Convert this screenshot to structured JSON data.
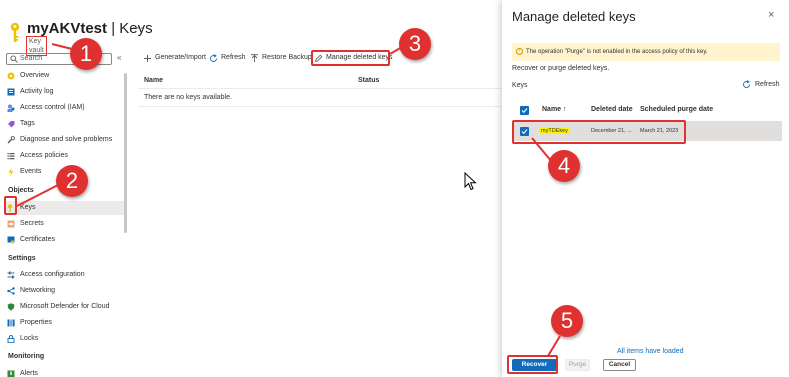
{
  "header": {
    "resource_name": "myAKVtest",
    "separator": "|",
    "page": "Keys",
    "more": "···",
    "resource_type": "Key vault"
  },
  "search": {
    "placeholder": "Search",
    "collapse": "«"
  },
  "sidebar": {
    "items": [
      {
        "label": "Overview",
        "icon": "overview-icon"
      },
      {
        "label": "Activity log",
        "icon": "activity-log-icon"
      },
      {
        "label": "Access control (IAM)",
        "icon": "iam-icon"
      },
      {
        "label": "Tags",
        "icon": "tag-icon"
      },
      {
        "label": "Diagnose and solve problems",
        "icon": "wrench-icon"
      },
      {
        "label": "Access policies",
        "icon": "list-icon"
      },
      {
        "label": "Events",
        "icon": "lightning-icon"
      }
    ],
    "objects_heading": "Objects",
    "objects": [
      {
        "label": "Keys",
        "icon": "key-icon",
        "selected": true
      },
      {
        "label": "Secrets",
        "icon": "secret-icon"
      },
      {
        "label": "Certificates",
        "icon": "certificate-icon"
      }
    ],
    "settings_heading": "Settings",
    "settings": [
      {
        "label": "Access configuration",
        "icon": "sliders-icon"
      },
      {
        "label": "Networking",
        "icon": "network-icon"
      },
      {
        "label": "Microsoft Defender for Cloud",
        "icon": "shield-icon"
      },
      {
        "label": "Properties",
        "icon": "properties-icon"
      },
      {
        "label": "Locks",
        "icon": "lock-icon"
      }
    ],
    "monitoring_heading": "Monitoring",
    "monitoring": [
      {
        "label": "Alerts",
        "icon": "alerts-icon"
      }
    ]
  },
  "toolbar": {
    "generate": "Generate/Import",
    "refresh": "Refresh",
    "restore": "Restore Backup",
    "manage_deleted": "Manage deleted keys"
  },
  "table": {
    "col_name": "Name",
    "col_status": "Status",
    "empty_message": "There are no keys available."
  },
  "panel": {
    "title": "Manage deleted keys",
    "close": "×",
    "warning": "The operation \"Purge\" is not enabled in the access policy of this key.",
    "subtitle": "Recover or purge deleted keys.",
    "keys_label": "Keys",
    "refresh": "Refresh",
    "columns": {
      "name": "Name ↑",
      "deleted": "Deleted date",
      "purge": "Scheduled purge date"
    },
    "rows": [
      {
        "name": "myTDEkey",
        "deleted": "December 21, ...",
        "purge": "March 21, 2023",
        "checked": true
      }
    ],
    "all_loaded": "All items have loaded",
    "recover": "Recover",
    "purge_btn": "Purge",
    "cancel": "Cancel"
  },
  "annotations": [
    "1",
    "2",
    "3",
    "4",
    "5"
  ],
  "colors": {
    "accent": "#0f6cbd",
    "annotation": "#e03131",
    "highlight": "#fff200"
  }
}
